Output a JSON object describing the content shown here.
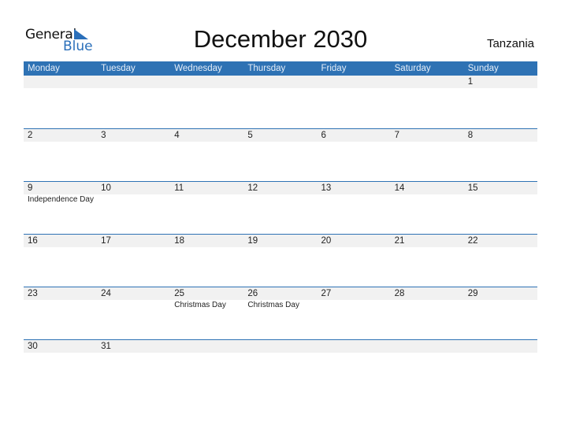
{
  "logo": {
    "line1": "General",
    "line2": "Blue",
    "accent_color": "#2a6fba"
  },
  "title": "December 2030",
  "country": "Tanzania",
  "colors": {
    "header_bg": "#2e72b4",
    "date_strip_bg": "#f1f1f1"
  },
  "weekdays": [
    "Monday",
    "Tuesday",
    "Wednesday",
    "Thursday",
    "Friday",
    "Saturday",
    "Sunday"
  ],
  "weeks": [
    [
      {
        "day": ""
      },
      {
        "day": ""
      },
      {
        "day": ""
      },
      {
        "day": ""
      },
      {
        "day": ""
      },
      {
        "day": ""
      },
      {
        "day": "1"
      }
    ],
    [
      {
        "day": "2"
      },
      {
        "day": "3"
      },
      {
        "day": "4"
      },
      {
        "day": "5"
      },
      {
        "day": "6"
      },
      {
        "day": "7"
      },
      {
        "day": "8"
      }
    ],
    [
      {
        "day": "9",
        "event": "Independence Day"
      },
      {
        "day": "10"
      },
      {
        "day": "11"
      },
      {
        "day": "12"
      },
      {
        "day": "13"
      },
      {
        "day": "14"
      },
      {
        "day": "15"
      }
    ],
    [
      {
        "day": "16"
      },
      {
        "day": "17"
      },
      {
        "day": "18"
      },
      {
        "day": "19"
      },
      {
        "day": "20"
      },
      {
        "day": "21"
      },
      {
        "day": "22"
      }
    ],
    [
      {
        "day": "23"
      },
      {
        "day": "24"
      },
      {
        "day": "25",
        "event": "Christmas Day"
      },
      {
        "day": "26",
        "event": "Christmas Day"
      },
      {
        "day": "27"
      },
      {
        "day": "28"
      },
      {
        "day": "29"
      }
    ],
    [
      {
        "day": "30"
      },
      {
        "day": "31"
      },
      {
        "day": ""
      },
      {
        "day": ""
      },
      {
        "day": ""
      },
      {
        "day": ""
      },
      {
        "day": ""
      }
    ]
  ]
}
